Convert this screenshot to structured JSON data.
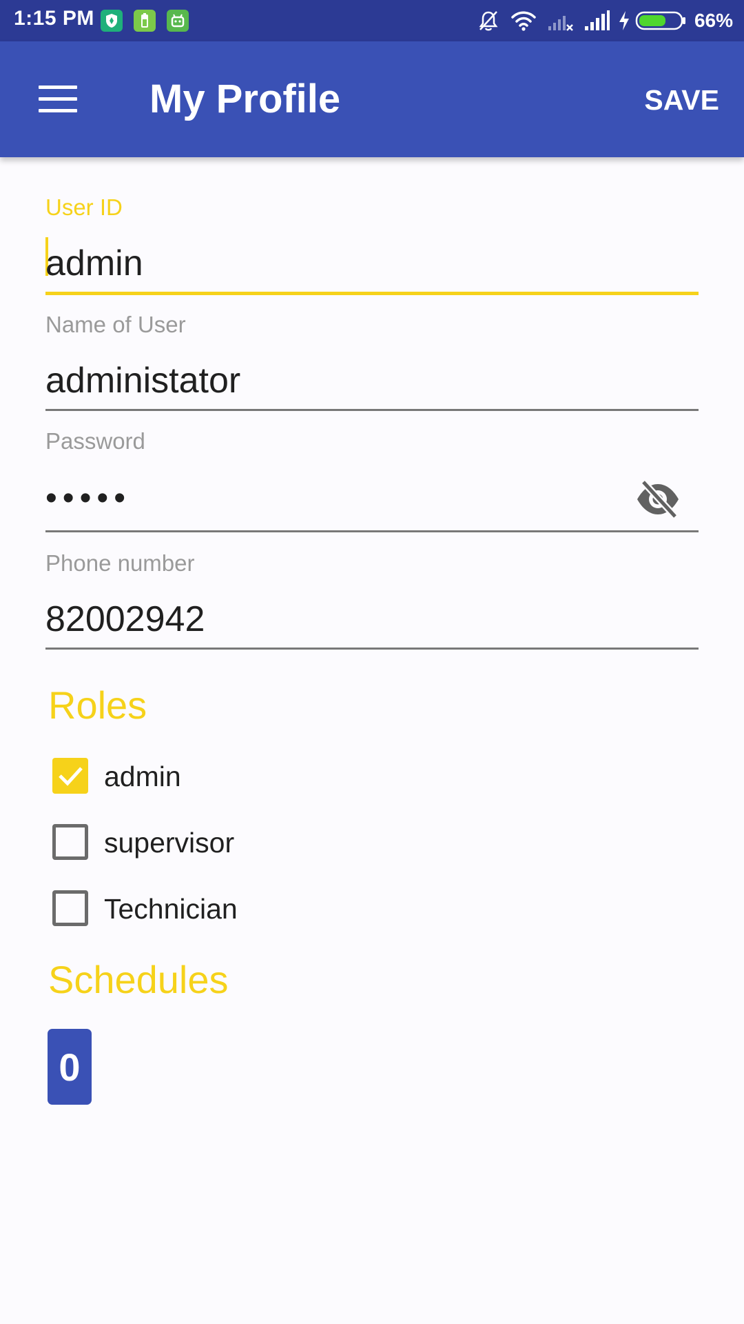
{
  "status_bar": {
    "time": "1:15 PM",
    "battery_percent": "66%",
    "battery_level": 0.66,
    "icons": [
      "shield-app-icon",
      "battery-app-icon",
      "android-app-icon",
      "notifications-muted-icon",
      "wifi-icon",
      "signal-no-service-icon",
      "signal-icon",
      "charging-icon",
      "battery-icon"
    ]
  },
  "app_bar": {
    "title": "My Profile",
    "save_label": "SAVE",
    "menu_icon": "hamburger-menu-icon"
  },
  "form": {
    "user_id": {
      "label": "User ID",
      "value": "admin"
    },
    "name_of_user": {
      "label": "Name of User",
      "value": "administator"
    },
    "password": {
      "label": "Password",
      "value": "•••••",
      "toggle_icon": "visibility-off-icon"
    },
    "phone_number": {
      "label": "Phone number",
      "value": "82002942"
    }
  },
  "roles": {
    "title": "Roles",
    "items": [
      {
        "label": "admin",
        "checked": true
      },
      {
        "label": "supervisor",
        "checked": false
      },
      {
        "label": "Technician",
        "checked": false
      }
    ]
  },
  "schedules": {
    "title": "Schedules",
    "items": [
      {
        "label": "0"
      }
    ]
  },
  "colors": {
    "status_bar": "#2c3a94",
    "app_bar": "#3a51b5",
    "accent": "#f6d21a",
    "background": "#fcfbfe"
  }
}
